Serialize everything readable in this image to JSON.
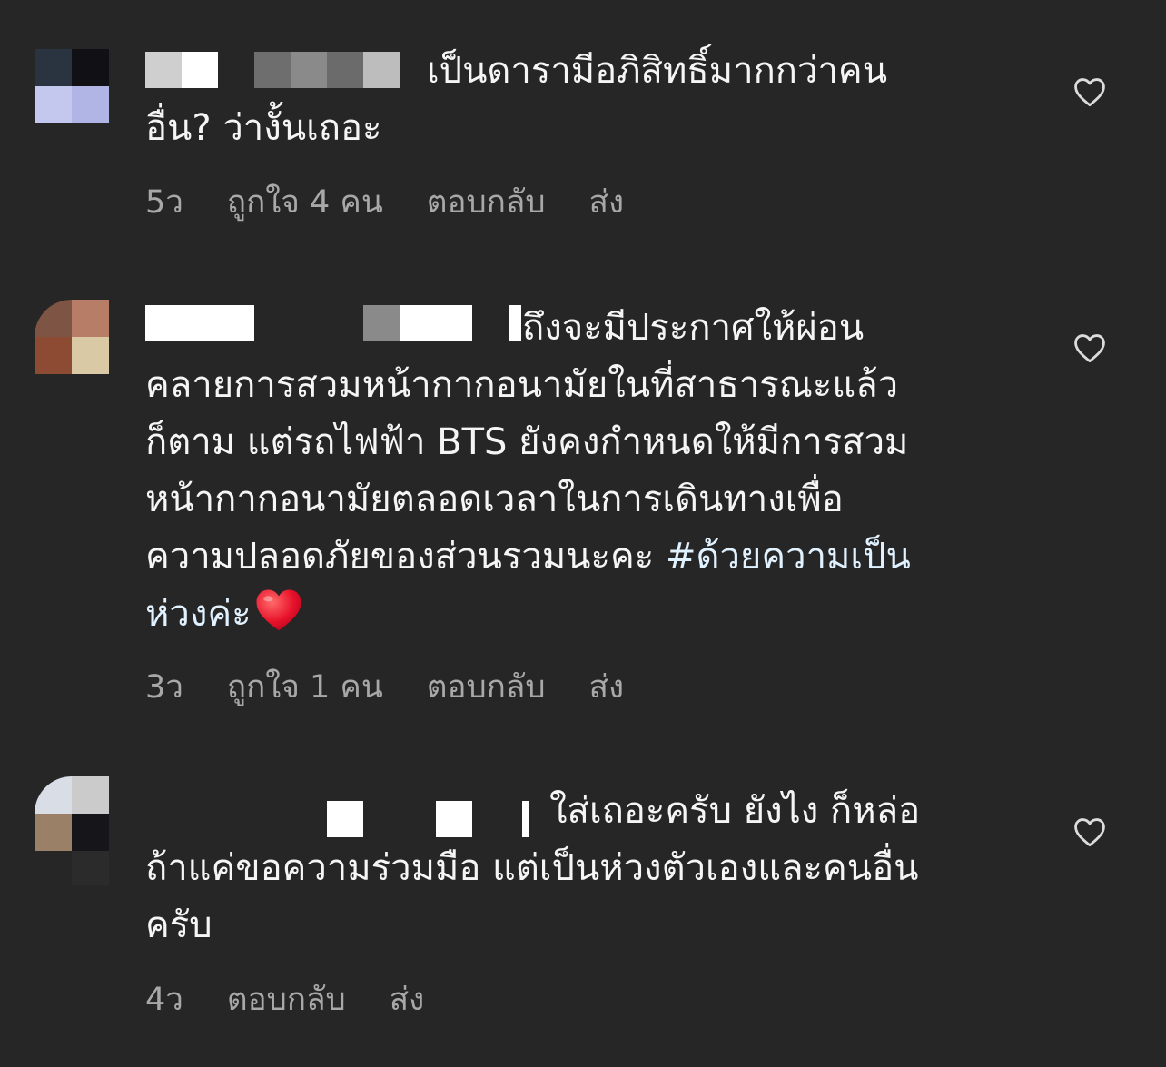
{
  "comments": [
    {
      "username_redacted": true,
      "first_line": "เป็นดารามีอภิสิทธิ์มากกว่าคน",
      "rest_lines": [
        "อื่น? ว่างั้นเถอะ"
      ],
      "time": "5ว",
      "likes": "ถูกใจ 4 คน",
      "reply": "ตอบกลับ",
      "send": "ส่ง",
      "avatar_colors": [
        "#2a3340",
        "#101015",
        "#c4c8ef",
        "#b0b5e6"
      ]
    },
    {
      "username_redacted": true,
      "first_line": "ถึงจะมีประกาศให้ผ่อน",
      "rest_lines": [
        "คลายการสวมหน้ากากอนามัยในที่สาธารณะแล้ว",
        "ก็ตาม แต่รถไฟฟ้า BTS ยังคงกำหนดให้มีการสวม",
        "หน้ากากอนามัยตลอดเวลาในการเดินทางเพื่อ",
        "ความปลอดภัยของส่วนรวมนะคะ "
      ],
      "hashtag_part1": "#ด้วยความเป็น",
      "hashtag_part2": "ห่วงค่ะ",
      "emoji": "red-heart",
      "time": "3ว",
      "likes": "ถูกใจ 1 คน",
      "reply": "ตอบกลับ",
      "send": "ส่ง",
      "avatar_colors": [
        "#7e5444",
        "#b77d66",
        "#8e4b33",
        "#dac9a5"
      ]
    },
    {
      "username_redacted": true,
      "first_line": "ใส่เถอะครับ ยังไง ก็หล่อ",
      "rest_lines": [
        "ถ้าแค่ขอความร่วมมือ แต่เป็นห่วงตัวเองและคนอื่น",
        "ครับ"
      ],
      "time": "4ว",
      "reply": "ตอบกลับ",
      "send": "ส่ง",
      "avatar_colors": [
        "#d8dde6",
        "#cbcbcb",
        "#9a8066",
        "#15151a",
        "#2b2b2b"
      ]
    }
  ],
  "colors": {
    "background": "#262626",
    "text": "#f5f5f5",
    "meta": "#a8a8a8",
    "hashtag": "#e0f1ff"
  }
}
